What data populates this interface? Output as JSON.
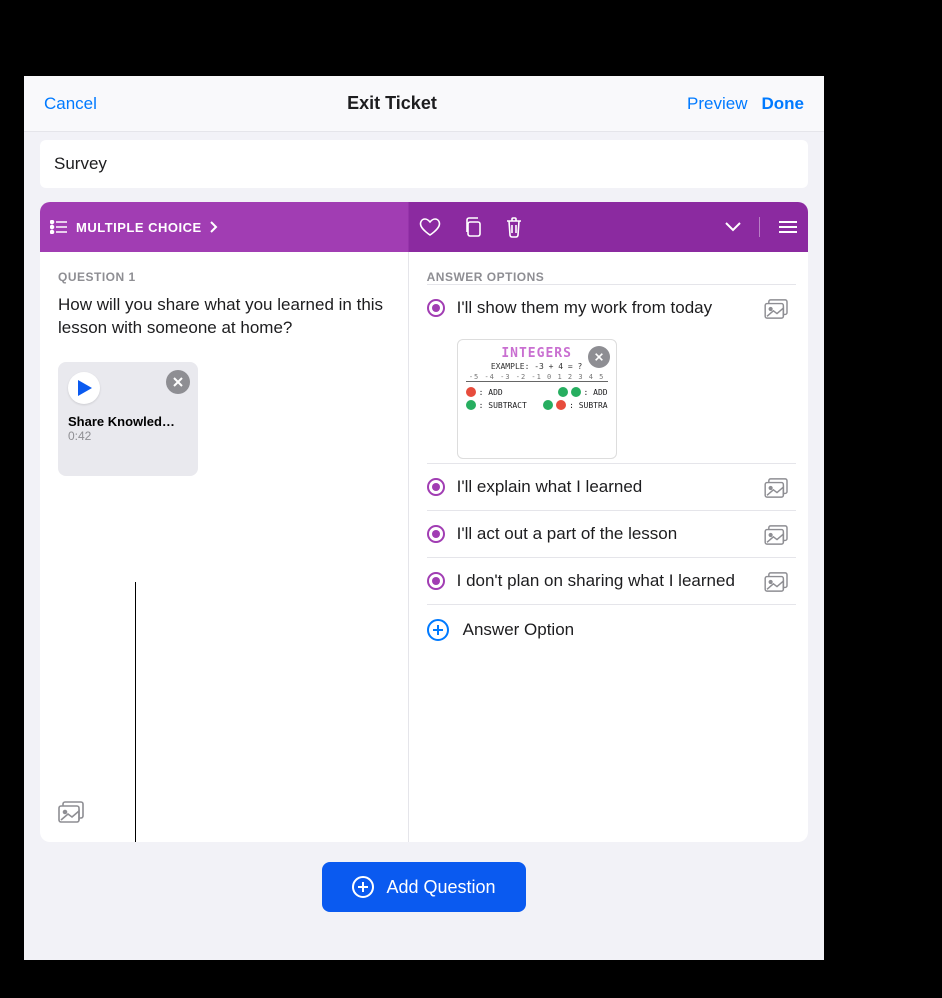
{
  "nav": {
    "cancel": "Cancel",
    "title": "Exit Ticket",
    "preview": "Preview",
    "done": "Done"
  },
  "title_field": {
    "value": "Survey"
  },
  "question_header": {
    "type_label": "MULTIPLE CHOICE"
  },
  "question": {
    "label": "QUESTION 1",
    "text": "How will you share what you learned in this lesson with someone at home?",
    "media": {
      "title": "Share Knowled…",
      "duration": "0:42"
    }
  },
  "answers": {
    "label": "ANSWER OPTIONS",
    "options": [
      "I'll show them my work from today",
      "I'll explain what I learned",
      "I'll act out a part of the lesson",
      "I don't plan on sharing what I learned"
    ],
    "add_label": "Answer Option",
    "attachment": {
      "heading": "INTEGERS",
      "example": "EXAMPLE: -3 + 4 = ?",
      "rows": [
        {
          "l_op": ": ADD",
          "r_op": ": ADD"
        },
        {
          "l_op": ": SUBTRACT",
          "r_op": ": SUBTRA"
        }
      ]
    }
  },
  "add_question": "Add Question",
  "colors": {
    "blue": "#007aff",
    "purple": "#a13db3"
  }
}
